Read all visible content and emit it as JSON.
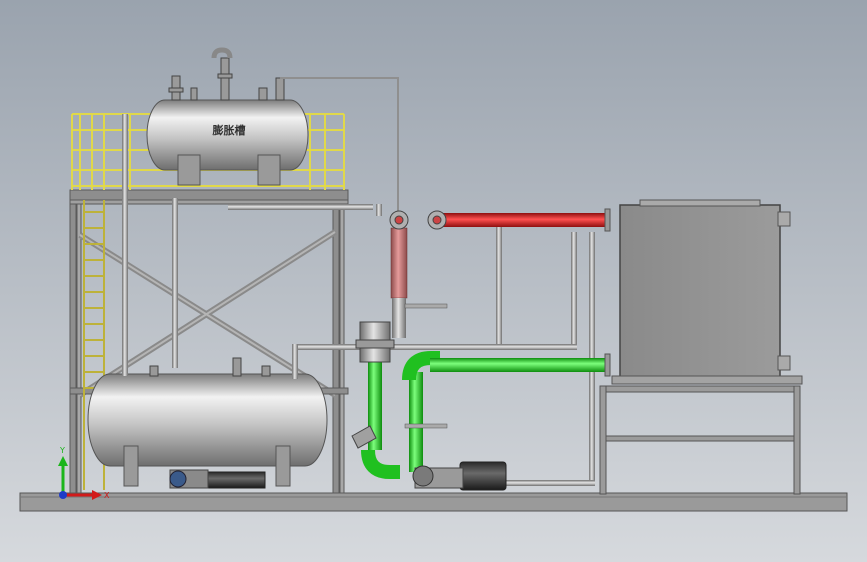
{
  "tank_label": "膨胀槽",
  "triad": {
    "x_label": "X",
    "y_label": "Y"
  },
  "colors": {
    "background_top": "#9aa3ae",
    "background_bottom": "#d6d9dd",
    "steel": "#8e8e8e",
    "railing": "#e0d84a",
    "hot_pipe": "#e23131",
    "pipe_red": "#c86464",
    "flow_pipe": "#22e022",
    "tank_body": "#c9c9c9",
    "base": "#9a9a9a"
  }
}
